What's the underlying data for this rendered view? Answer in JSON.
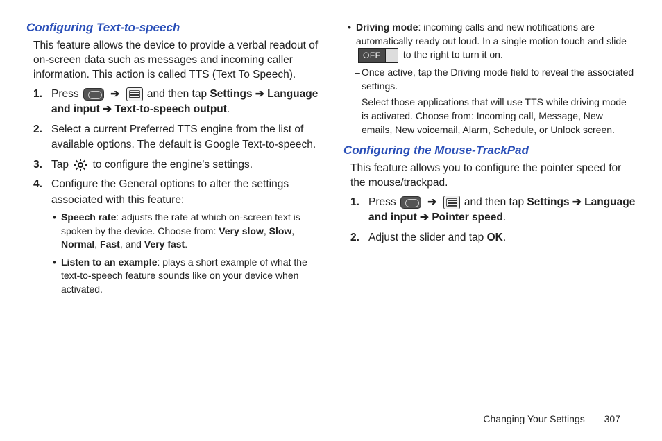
{
  "left": {
    "title": "Configuring Text-to-speech",
    "intro": "This feature allows the device to provide a verbal readout of on-screen data such as messages and incoming caller information. This action is called TTS (Text To Speech).",
    "step1_a": "Press",
    "step1_b": "and then tap",
    "step1_c": "Settings ➔ Language and input ➔ Text-to-speech output",
    "step2": "Select a current Preferred TTS engine from the list of available options. The default is Google Text-to-speech.",
    "step3_a": "Tap",
    "step3_b": "to configure the engine's settings.",
    "step4": "Configure the General options to alter the settings associated with this feature:",
    "bullet1_label": "Speech rate",
    "bullet1_text": ": adjusts the rate at which on-screen text is spoken by the device. Choose from: ",
    "bullet1_opts_a": "Very slow",
    "bullet1_opts_b": "Slow",
    "bullet1_opts_c": "Normal",
    "bullet1_opts_d": "Fast",
    "bullet1_opts_e": "Very fast",
    "bullet2_label": "Listen to an example",
    "bullet2_text": ": plays a short example of what the text-to-speech feature sounds like on your device when activated."
  },
  "right": {
    "drive_label": "Driving mode",
    "drive_text_a": ": incoming calls and new notifications are automatically ready out loud. In a single motion touch and slide",
    "drive_text_b": "to the right to turn it on.",
    "off_label": "OFF",
    "dash1": "Once active, tap the Driving mode field to reveal the associated settings.",
    "dash2": "Select those applications that will use TTS while driving mode is activated. Choose from: Incoming call, Message, New emails, New voicemail, Alarm, Schedule, or Unlock screen.",
    "title2": "Configuring the Mouse-TrackPad",
    "intro2": "This feature allows you to configure the pointer speed for the mouse/trackpad.",
    "s1_a": "Press",
    "s1_b": "and then tap",
    "s1_c": "Settings ➔ Language and input ➔ Pointer speed",
    "s2_a": "Adjust the slider and tap ",
    "s2_b": "OK",
    "s2_c": "."
  },
  "footer": {
    "section": "Changing Your Settings",
    "page": "307"
  }
}
